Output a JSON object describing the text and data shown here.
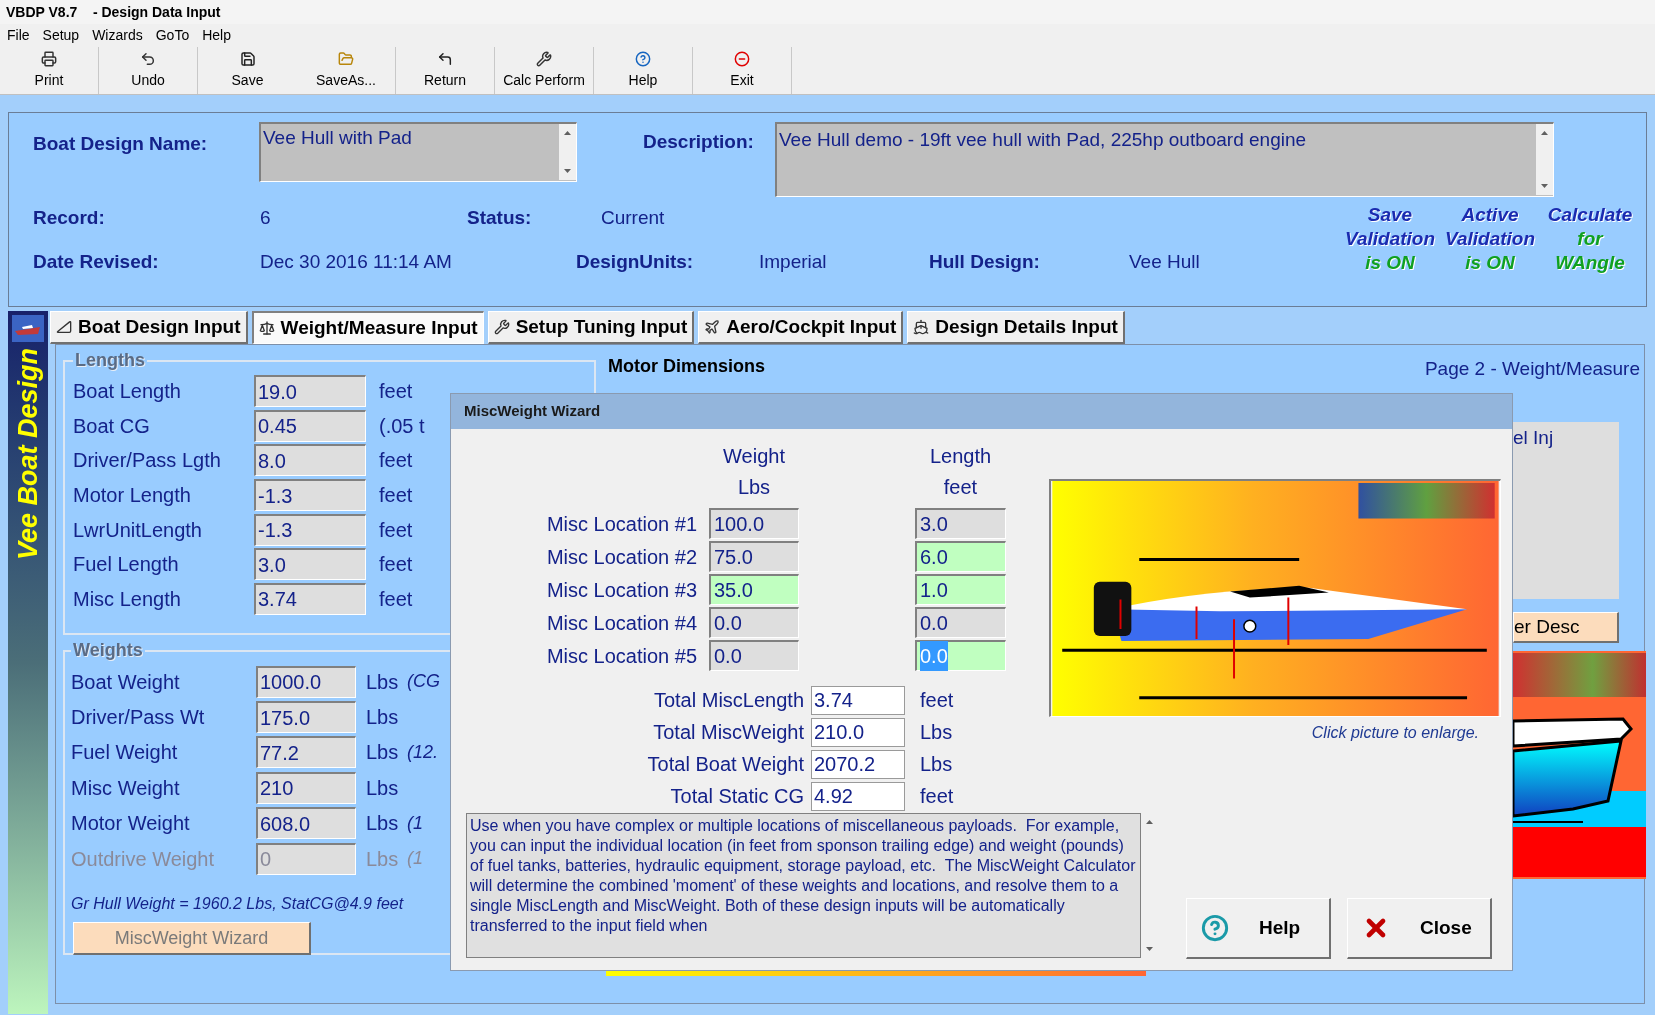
{
  "window": {
    "title": "VBDP V8.7    - Design Data Input"
  },
  "menu": [
    "File",
    "Setup",
    "Wizards",
    "GoTo",
    "Help"
  ],
  "toolbar": [
    "Print",
    "Undo",
    "Save",
    "SaveAs...",
    "Return",
    "Calc Perform",
    "Help",
    "Exit"
  ],
  "header": {
    "name_label": "Boat Design Name:",
    "name_value": "Vee Hull with Pad",
    "description_label": "Description:",
    "description_value": "Vee Hull demo - 19ft vee hull with Pad, 225hp outboard engine",
    "fields": [
      {
        "label": "Record:",
        "value": "6"
      },
      {
        "label": "Status:",
        "value": "Current"
      },
      {
        "label": "Date Revised:",
        "value": "Dec 30 2016 11:14 AM"
      },
      {
        "label": "DesignUnits:",
        "value": "Imperial"
      },
      {
        "label": "Hull Design:",
        "value": "Vee Hull"
      }
    ],
    "badges": [
      {
        "lines": [
          "Save",
          "Validation",
          "is ON"
        ]
      },
      {
        "lines": [
          "Active",
          "Validation",
          "is ON"
        ]
      },
      {
        "lines": [
          "Calculate",
          "for",
          "WAngle"
        ]
      }
    ]
  },
  "side_banner": {
    "title": "Vee Boat Design"
  },
  "tabs": [
    {
      "label": "Boat Design Input",
      "selected": false
    },
    {
      "label": "Weight/Measure Input",
      "selected": true
    },
    {
      "label": "Setup Tuning Input",
      "selected": false
    },
    {
      "label": "Aero/Cockpit Input",
      "selected": false
    },
    {
      "label": "Design Details Input",
      "selected": false
    }
  ],
  "lengths": {
    "title": "Lengths",
    "rows": [
      {
        "label": "Boat Length",
        "value": "19.0",
        "unit": "feet"
      },
      {
        "label": "Boat CG",
        "value": "0.45",
        "unit": "(.05 t"
      },
      {
        "label": "Driver/Pass Lgth",
        "value": "8.0",
        "unit": "feet"
      },
      {
        "label": "Motor Length",
        "value": "-1.3",
        "unit": "feet"
      },
      {
        "label": "LwrUnitLength",
        "value": "-1.3",
        "unit": "feet"
      },
      {
        "label": "Fuel Length",
        "value": "3.0",
        "unit": "feet"
      },
      {
        "label": "Misc Length",
        "value": "3.74",
        "unit": "feet"
      }
    ]
  },
  "weights": {
    "title": "Weights",
    "rows": [
      {
        "label": "Boat Weight",
        "value": "1000.0",
        "unit": "Lbs",
        "note": "(CG",
        "disabled": false
      },
      {
        "label": "Driver/Pass Wt",
        "value": "175.0",
        "unit": "Lbs",
        "disabled": false
      },
      {
        "label": "Fuel Weight",
        "value": "77.2",
        "unit": "Lbs",
        "note": "(12.",
        "disabled": false
      },
      {
        "label": "Misc Weight",
        "value": "210",
        "unit": "Lbs",
        "disabled": false
      },
      {
        "label": "Motor Weight",
        "value": "608.0",
        "unit": "Lbs",
        "note": "(1",
        "disabled": false
      },
      {
        "label": "Outdrive Weight",
        "value": "0",
        "unit": "Lbs",
        "note": "(1",
        "disabled": true
      }
    ],
    "summary": "Gr Hull Weight = 1960.2 Lbs, StatCG@4.9 feet",
    "button": "MiscWeight Wizard"
  },
  "motor_dimensions": {
    "title": "Motor Dimensions"
  },
  "page_label": "Page 2 - Weight/Measure",
  "right_panel": {
    "text": "el Inj",
    "button": "er Desc"
  },
  "dialog": {
    "title": "MiscWeight Wizard",
    "columns": [
      {
        "label": "Weight",
        "unit": "Lbs"
      },
      {
        "label": "Length",
        "unit": "feet"
      }
    ],
    "rows": [
      {
        "label": "Misc Location #1",
        "weight": {
          "value": "100.0",
          "highlighted": false,
          "selected": false
        },
        "length": {
          "value": "3.0",
          "highlighted": false,
          "selected": false
        }
      },
      {
        "label": "Misc Location #2",
        "weight": {
          "value": "75.0",
          "highlighted": false,
          "selected": false
        },
        "length": {
          "value": "6.0",
          "highlighted": true,
          "selected": false
        }
      },
      {
        "label": "Misc Location #3",
        "weight": {
          "value": "35.0",
          "highlighted": true,
          "selected": false
        },
        "length": {
          "value": "1.0",
          "highlighted": true,
          "selected": false
        }
      },
      {
        "label": "Misc Location #4",
        "weight": {
          "value": "0.0",
          "highlighted": false,
          "selected": false
        },
        "length": {
          "value": "0.0",
          "highlighted": false,
          "selected": false
        }
      },
      {
        "label": "Misc Location #5",
        "weight": {
          "value": "0.0",
          "highlighted": false,
          "selected": false
        },
        "length": {
          "value": "0.0",
          "highlighted": true,
          "selected": true
        }
      }
    ],
    "totals": [
      {
        "label": "Total MiscLength",
        "value": "3.74",
        "unit": "feet"
      },
      {
        "label": "Total MiscWeight",
        "value": "210.0",
        "unit": "Lbs"
      },
      {
        "label": "Total Boat Weight",
        "value": "2070.2",
        "unit": "Lbs"
      },
      {
        "label": "Total Static CG",
        "value": "4.92",
        "unit": "feet"
      }
    ],
    "description": "Use when you have complex or multiple locations of miscellaneous payloads.  For example, you can input the individual location (in feet from sponson trailing edge) and weight (pounds) of fuel tanks, batteries, hydraulic equipment, storage payload, etc.  The MiscWeight Calculator will determine the combined 'moment' of these weights and locations, and resolve them to a single MiscLength and MiscWeight. Both of these design inputs will be automatically transferred to the input field when",
    "caption": "Click picture to enlarge.",
    "buttons": [
      "Help",
      "Close"
    ]
  }
}
